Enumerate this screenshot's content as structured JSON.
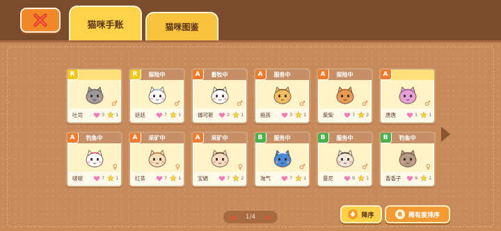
{
  "tabs": [
    {
      "label": "猫咪手账",
      "active": true
    },
    {
      "label": "猫咪图鉴",
      "active": false
    }
  ],
  "cats": [
    {
      "name": "吐司",
      "grade": "R",
      "status": "",
      "hearts": 3,
      "stars": 1,
      "gender": "♂",
      "fur": "#9a9a9a",
      "accent": "#6a6a6a"
    },
    {
      "name": "廷廷",
      "grade": "R",
      "status": "探险中",
      "hearts": 7,
      "stars": 1,
      "gender": "♂",
      "fur": "#ffffff",
      "accent": "#8ab6e0"
    },
    {
      "name": "娜可斯",
      "grade": "A",
      "status": "畜牧中",
      "hearts": 2,
      "stars": 1,
      "gender": "♂",
      "fur": "#ffffff",
      "accent": "#333333"
    },
    {
      "name": "拖孩",
      "grade": "A",
      "status": "服务中",
      "hearts": 3,
      "stars": 1,
      "gender": "♂",
      "fur": "#f0c060",
      "accent": "#8a6030"
    },
    {
      "name": "柴柴",
      "grade": "A",
      "status": "探险中",
      "hearts": 7,
      "stars": 2,
      "gender": "♂",
      "fur": "#e89a50",
      "accent": "#b86a30"
    },
    {
      "name": "唐唐",
      "grade": "A",
      "status": "",
      "hearts": 1,
      "stars": 1,
      "gender": "♂",
      "fur": "#e6a0d8",
      "accent": "#b060a0"
    },
    {
      "name": "啵啵",
      "grade": "A",
      "status": "钓鱼中",
      "hearts": 7,
      "stars": 1,
      "gender": "♀",
      "fur": "#ffffff",
      "accent": "#e05060"
    },
    {
      "name": "红茶",
      "grade": "A",
      "status": "采矿中",
      "hearts": 7,
      "stars": 1,
      "gender": "♀",
      "fur": "#f5ddb8",
      "accent": "#c08050"
    },
    {
      "name": "宝娟",
      "grade": "A",
      "status": "采矿中",
      "hearts": 7,
      "stars": 2,
      "gender": "♀",
      "fur": "#f4dcc0",
      "accent": "#5a3a20"
    },
    {
      "name": "淘气",
      "grade": "B",
      "status": "服务中",
      "hearts": 7,
      "stars": 1,
      "gender": "♂",
      "fur": "#4a8ad8",
      "accent": "#ffffff"
    },
    {
      "name": "曼尼",
      "grade": "B",
      "status": "服务中",
      "hearts": 9,
      "stars": 1,
      "gender": "♂",
      "fur": "#f0e6d8",
      "accent": "#4a3528"
    },
    {
      "name": "香香子",
      "grade": "B",
      "status": "钓鱼中",
      "hearts": 9,
      "stars": 1,
      "gender": "♀",
      "fur": "#b59a85",
      "accent": "#7a5a48"
    }
  ],
  "pager": {
    "text": "1/4"
  },
  "buttons": {
    "sort": "降序",
    "rarity": "稀有度排序"
  },
  "colors": {
    "grade_A": "#ee7b2e",
    "grade_R": "#f2c71f",
    "grade_B": "#49b04a"
  }
}
